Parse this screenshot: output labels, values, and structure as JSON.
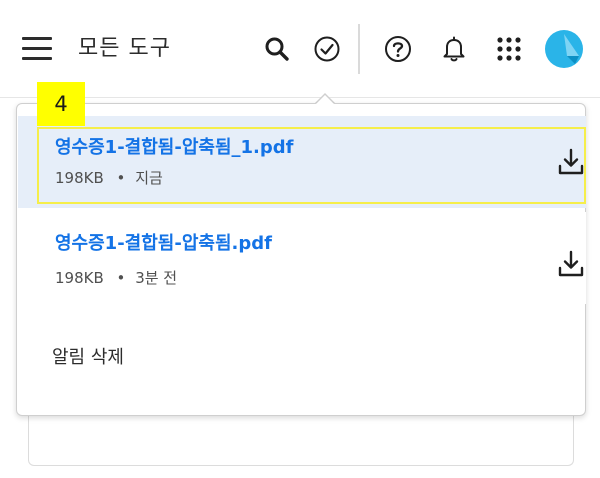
{
  "header": {
    "title": "모든 도구"
  },
  "annotation": {
    "badge_label": "4",
    "highlight_color": "#ffff00"
  },
  "notifications": {
    "items": [
      {
        "name": "영수증1-결합됨-압축됨_1.pdf",
        "size": "198KB",
        "time": "지금"
      },
      {
        "name": "영수증1-결합됨-압축됨.pdf",
        "size": "198KB",
        "time": "3분 전"
      }
    ],
    "separator": "•",
    "clear_label": "알림 삭제"
  },
  "icons": [
    "menu-icon",
    "search-icon",
    "task-check-icon",
    "help-icon",
    "bell-icon",
    "apps-grid-icon",
    "avatar",
    "download-icon"
  ],
  "colors": {
    "link": "#1473e6",
    "selected_bg": "#e6eef9",
    "avatar": "#2ab4e8"
  }
}
